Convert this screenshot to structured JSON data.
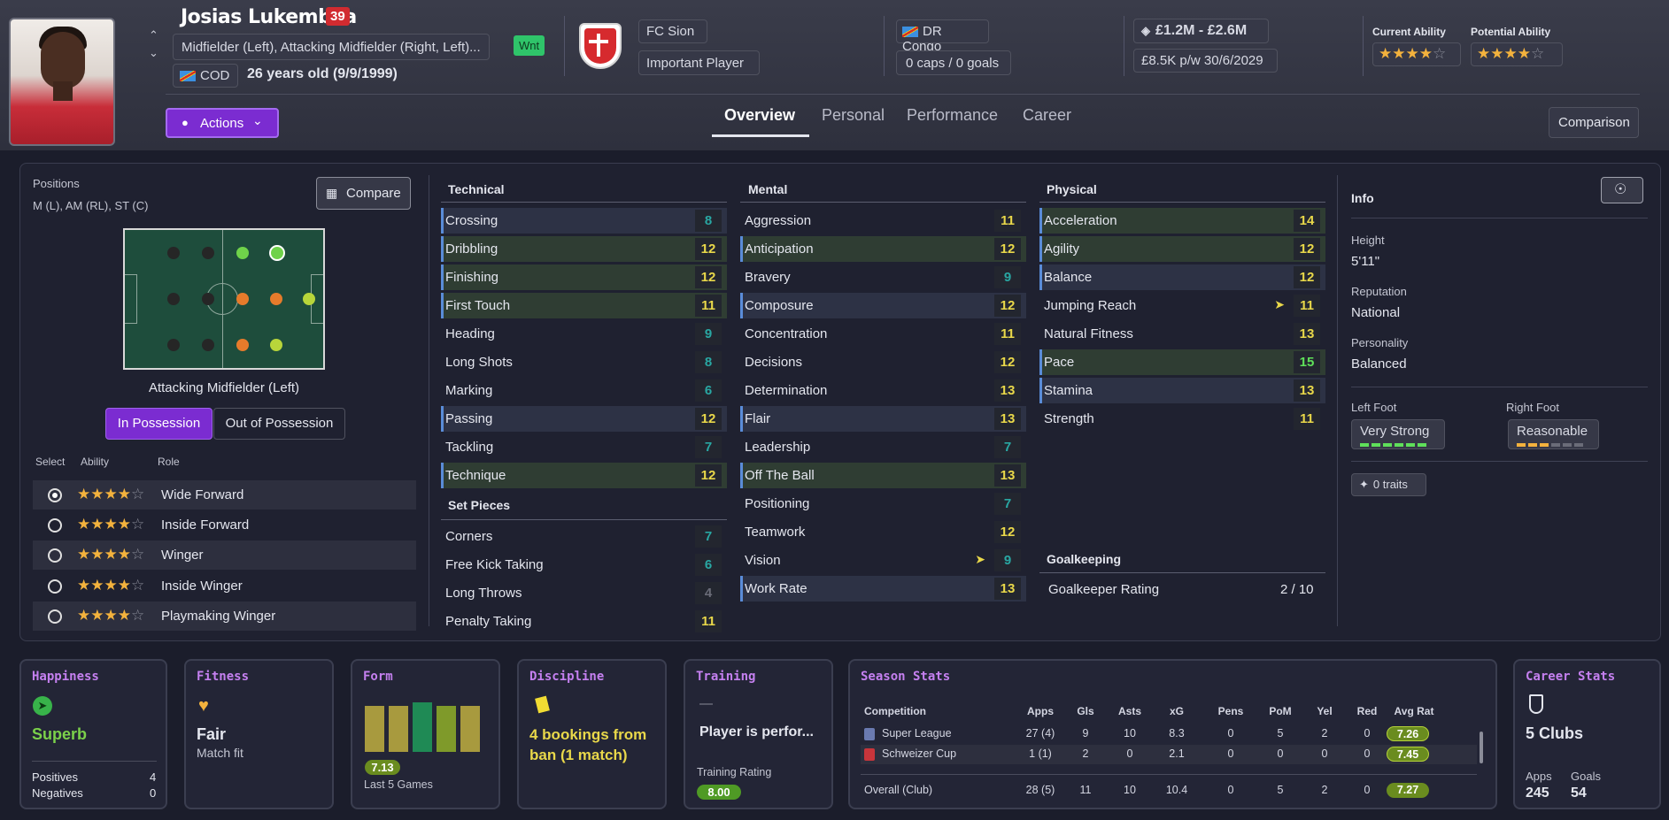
{
  "player": {
    "name": "Josias Lukembila",
    "number": "39",
    "positions_line": "Midfielder (Left), Attacking Midfielder (Right, Left)...",
    "nationality_code": "COD",
    "age": "26 years old (9/9/1999)",
    "badge": "Wnt"
  },
  "club": {
    "name": "FC Sion",
    "status": "Important Player"
  },
  "nation": {
    "name": "DR Congo",
    "caps": "0 caps / 0 goals"
  },
  "value": {
    "range": "£1.2M - £2.6M",
    "wage": "£8.5K p/w",
    "contract": "30/6/2029"
  },
  "ability": {
    "current_label": "Current Ability",
    "potential_label": "Potential Ability",
    "current_stars": 3.5,
    "potential_stars": 3.5
  },
  "actions_label": "Actions",
  "tabs": [
    "Overview",
    "Personal",
    "Performance",
    "Career"
  ],
  "comparison_label": "Comparison",
  "positions": {
    "title": "Positions",
    "list": "M (L), AM (RL), ST (C)",
    "compare_label": "Compare",
    "selected_position": "Attacking Midfielder (Left)",
    "in_possession": "In Possession",
    "out_possession": "Out of Possession",
    "col_select": "Select",
    "col_ability": "Ability",
    "col_role": "Role",
    "roles": [
      {
        "role": "Wide Forward",
        "stars": 3.5,
        "selected": true
      },
      {
        "role": "Inside Forward",
        "stars": 3.5,
        "selected": false
      },
      {
        "role": "Winger",
        "stars": 3.5,
        "selected": false
      },
      {
        "role": "Inside Winger",
        "stars": 3.5,
        "selected": false
      },
      {
        "role": "Playmaking Winger",
        "stars": 3.5,
        "selected": false
      }
    ]
  },
  "attributes": {
    "technical_title": "Technical",
    "technical": [
      {
        "name": "Crossing",
        "value": "8"
      },
      {
        "name": "Dribbling",
        "value": "12"
      },
      {
        "name": "Finishing",
        "value": "12"
      },
      {
        "name": "First Touch",
        "value": "11"
      },
      {
        "name": "Heading",
        "value": "9"
      },
      {
        "name": "Long Shots",
        "value": "8"
      },
      {
        "name": "Marking",
        "value": "6"
      },
      {
        "name": "Passing",
        "value": "12"
      },
      {
        "name": "Tackling",
        "value": "7"
      },
      {
        "name": "Technique",
        "value": "12"
      }
    ],
    "setpieces_title": "Set Pieces",
    "setpieces": [
      {
        "name": "Corners",
        "value": "7"
      },
      {
        "name": "Free Kick Taking",
        "value": "6"
      },
      {
        "name": "Long Throws",
        "value": "4"
      },
      {
        "name": "Penalty Taking",
        "value": "11"
      }
    ],
    "mental_title": "Mental",
    "mental": [
      {
        "name": "Aggression",
        "value": "11"
      },
      {
        "name": "Anticipation",
        "value": "12"
      },
      {
        "name": "Bravery",
        "value": "9"
      },
      {
        "name": "Composure",
        "value": "12"
      },
      {
        "name": "Concentration",
        "value": "11"
      },
      {
        "name": "Decisions",
        "value": "12"
      },
      {
        "name": "Determination",
        "value": "13"
      },
      {
        "name": "Flair",
        "value": "13"
      },
      {
        "name": "Leadership",
        "value": "7"
      },
      {
        "name": "Off The Ball",
        "value": "13"
      },
      {
        "name": "Positioning",
        "value": "7"
      },
      {
        "name": "Teamwork",
        "value": "12"
      },
      {
        "name": "Vision",
        "value": "9"
      },
      {
        "name": "Work Rate",
        "value": "13"
      }
    ],
    "physical_title": "Physical",
    "physical": [
      {
        "name": "Acceleration",
        "value": "14"
      },
      {
        "name": "Agility",
        "value": "12"
      },
      {
        "name": "Balance",
        "value": "12"
      },
      {
        "name": "Jumping Reach",
        "value": "11"
      },
      {
        "name": "Natural Fitness",
        "value": "13"
      },
      {
        "name": "Pace",
        "value": "15"
      },
      {
        "name": "Stamina",
        "value": "13"
      },
      {
        "name": "Strength",
        "value": "11"
      }
    ],
    "goalkeeping_title": "Goalkeeping",
    "gk_rating_label": "Goalkeeper Rating",
    "gk_rating": "2 / 10"
  },
  "info": {
    "title": "Info",
    "height_label": "Height",
    "height": "5'11\"",
    "reputation_label": "Reputation",
    "reputation": "National",
    "personality_label": "Personality",
    "personality": "Balanced",
    "left_foot_label": "Left Foot",
    "left_foot": "Very Strong",
    "right_foot_label": "Right Foot",
    "right_foot": "Reasonable",
    "traits": "0 traits"
  },
  "cards": {
    "happiness": {
      "title": "Happiness",
      "value": "Superb",
      "positives_label": "Positives",
      "positives": "4",
      "negatives_label": "Negatives",
      "negatives": "0"
    },
    "fitness": {
      "title": "Fitness",
      "value": "Fair",
      "sub": "Match fit"
    },
    "form": {
      "title": "Form",
      "rating": "7.13",
      "sub": "Last 5 Games"
    },
    "discipline": {
      "title": "Discipline",
      "text": "4 bookings from ban (1 match)"
    },
    "training": {
      "title": "Training",
      "dash": "—",
      "text": "Player is perfor...",
      "rating_label": "Training Rating",
      "rating": "8.00"
    },
    "season": {
      "title": "Season Stats",
      "headers": [
        "Competition",
        "Apps",
        "Gls",
        "Asts",
        "xG",
        "Pens",
        "PoM",
        "Yel",
        "Red",
        "Avg Rat"
      ],
      "rows": [
        [
          "Super League",
          "27 (4)",
          "9",
          "10",
          "8.3",
          "0",
          "5",
          "2",
          "0",
          "7.26"
        ],
        [
          "Schweizer Cup",
          "1 (1)",
          "2",
          "0",
          "2.1",
          "0",
          "0",
          "0",
          "0",
          "7.45"
        ]
      ],
      "total": [
        "Overall (Club)",
        "28 (5)",
        "11",
        "10",
        "10.4",
        "0",
        "5",
        "2",
        "0",
        "7.27"
      ]
    },
    "career": {
      "title": "Career Stats",
      "value": "5 Clubs",
      "apps_label": "Apps",
      "apps": "245",
      "goals_label": "Goals",
      "goals": "54"
    }
  },
  "colors": {
    "accent": "#7b2cd1",
    "high": "#e9d84a",
    "top": "#5fe05a",
    "low": "#29a7a3"
  }
}
